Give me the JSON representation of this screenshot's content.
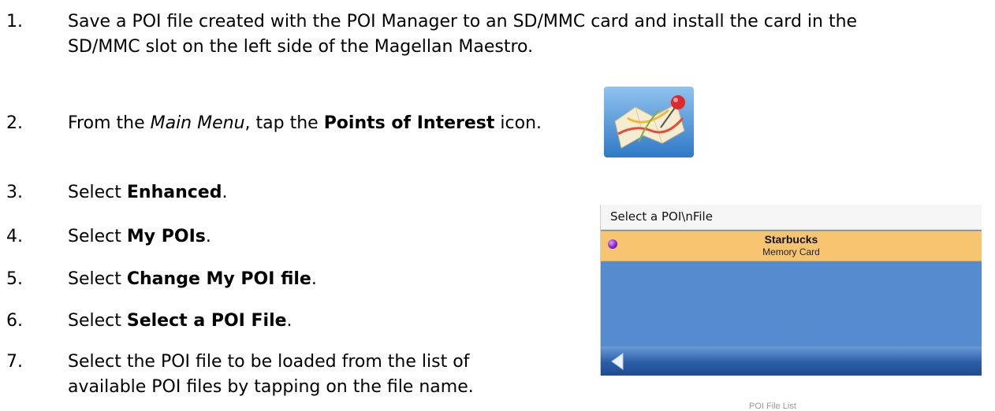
{
  "steps": [
    {
      "num": "1.",
      "text": "Save a POI file created with the POI Manager to an SD/MMC card and install the card in the",
      "cont": "SD/MMC slot on the left side of the Magellan Maestro."
    },
    {
      "num": "2.",
      "pre": "From the ",
      "italic": "Main Menu",
      "mid": ", tap the ",
      "bold": "Points of Interest",
      "post": " icon."
    },
    {
      "num": "3.",
      "pre": "Select ",
      "bold": "Enhanced",
      "post": "."
    },
    {
      "num": "4.",
      "pre": "Select ",
      "bold": "My POIs",
      "post": "."
    },
    {
      "num": "5.",
      "pre": "Select ",
      "bold": "Change My POI file",
      "post": "."
    },
    {
      "num": "6.",
      "pre": "Select ",
      "bold": "Select a POI File",
      "post": "."
    },
    {
      "num": "7.",
      "text": "Select the POI file to be loaded from the list of",
      "cont": "available POI files by tapping on the file name."
    }
  ],
  "icons": {
    "poi": "map-with-pin-icon",
    "back": "back-arrow-icon",
    "bullet": "purple-bullet-icon"
  },
  "screen": {
    "header": "Select a POI\\nFile",
    "item_name": "Starbucks",
    "item_location": "Memory Card"
  },
  "caption": "POI File List",
  "colors": {
    "screen_bg": "#558cd0",
    "row_highlight": "#f7c470",
    "bar": "#2b5da8"
  }
}
